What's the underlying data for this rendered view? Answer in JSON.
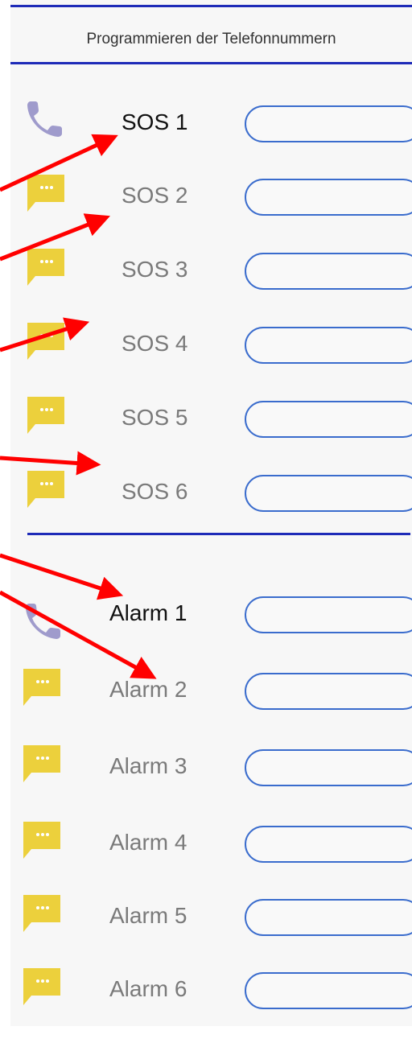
{
  "header": {
    "title": "Programmieren der Telefonnummern"
  },
  "colors": {
    "accent": "#1e2bb8",
    "field_border": "#3a6ccd",
    "message_icon": "#ecd03c",
    "phone_icon": "#9f9bcc",
    "arrow": "#ff0000"
  },
  "sos": [
    {
      "label": "SOS 1",
      "icon": "phone-icon",
      "value": ""
    },
    {
      "label": "SOS 2",
      "icon": "message-icon",
      "value": ""
    },
    {
      "label": "SOS 3",
      "icon": "message-icon",
      "value": ""
    },
    {
      "label": "SOS 4",
      "icon": "message-icon",
      "value": ""
    },
    {
      "label": "SOS 5",
      "icon": "message-icon",
      "value": ""
    },
    {
      "label": "SOS 6",
      "icon": "message-icon",
      "value": ""
    }
  ],
  "alarm": [
    {
      "label": "Alarm 1",
      "icon": "phone-icon",
      "value": ""
    },
    {
      "label": "Alarm 2",
      "icon": "message-icon",
      "value": ""
    },
    {
      "label": "Alarm 3",
      "icon": "message-icon",
      "value": ""
    },
    {
      "label": "Alarm 4",
      "icon": "message-icon",
      "value": ""
    },
    {
      "label": "Alarm 5",
      "icon": "message-icon",
      "value": ""
    },
    {
      "label": "Alarm 6",
      "icon": "message-icon",
      "value": ""
    }
  ]
}
